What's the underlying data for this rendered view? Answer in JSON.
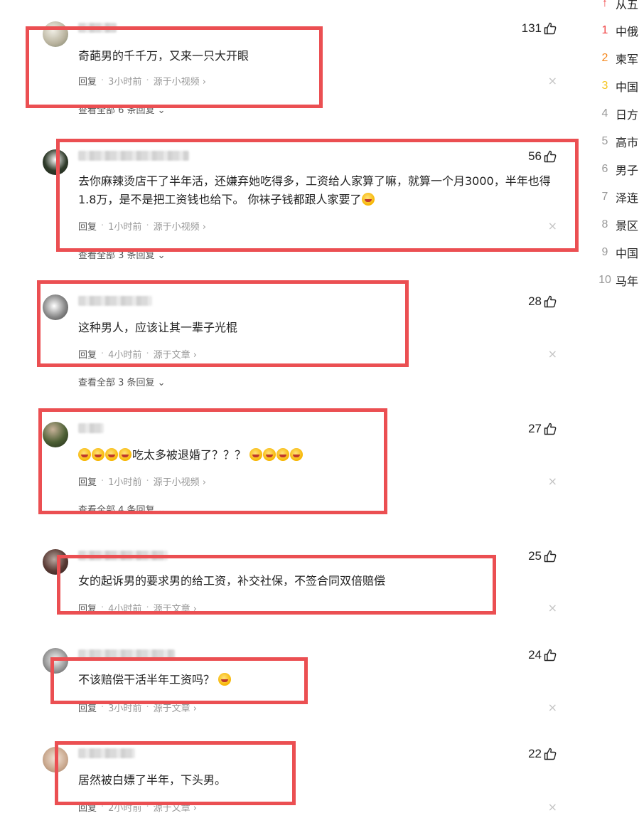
{
  "comments": [
    {
      "likes": "131",
      "text": "奇葩男的千千万，又来一只大开眼",
      "reply": "回复",
      "time": "3小时前",
      "source": "源于小视频 ›",
      "view_all": "查看全部 6 条回复 ⌄"
    },
    {
      "likes": "56",
      "text": "去你麻辣烫店干了半年活，还嫌弃她吃得多，工资给人家算了嘛，就算一个月3000，半年也得1.8万，是不是把工资钱也给下。 你袜子钱都跟人家要了",
      "reply": "回复",
      "time": "1小时前",
      "source": "源于小视频 ›",
      "view_all": "查看全部 3 条回复 ⌄"
    },
    {
      "likes": "28",
      "text": "这种男人，应该让其一辈子光棍",
      "reply": "回复",
      "time": "4小时前",
      "source": "源于文章 ›",
      "view_all": "查看全部 3 条回复 ⌄"
    },
    {
      "likes": "27",
      "text": "吃太多被退婚了？？？",
      "reply": "回复",
      "time": "1小时前",
      "source": "源于小视频 ›",
      "view_all": "查看全部 4 条回复 ⌄"
    },
    {
      "likes": "25",
      "text": "女的起诉男的要求男的给工资，补交社保，不签合同双倍赔偿",
      "reply": "回复",
      "time": "4小时前",
      "source": "源于文章 ›"
    },
    {
      "likes": "24",
      "text": "不该赔偿干活半年工资吗？",
      "reply": "回复",
      "time": "3小时前",
      "source": "源于文章 ›"
    },
    {
      "likes": "22",
      "text": "居然被白嫖了半年，下头男。",
      "reply": "回复",
      "time": "2小时前",
      "source": "源于文章 ›"
    }
  ],
  "hot_list": [
    {
      "rank": "↑",
      "title": "从五",
      "color": "#f04142"
    },
    {
      "rank": "1",
      "title": "中俄",
      "color": "#f04142"
    },
    {
      "rank": "2",
      "title": "柬军",
      "color": "#f5891f"
    },
    {
      "rank": "3",
      "title": "中国",
      "color": "#f5c51f"
    },
    {
      "rank": "4",
      "title": "日方",
      "color": "#999999"
    },
    {
      "rank": "5",
      "title": "高市",
      "color": "#999999"
    },
    {
      "rank": "6",
      "title": "男子",
      "color": "#999999"
    },
    {
      "rank": "7",
      "title": "泽连",
      "color": "#999999"
    },
    {
      "rank": "8",
      "title": "景区",
      "color": "#999999"
    },
    {
      "rank": "9",
      "title": "中国",
      "color": "#999999"
    },
    {
      "rank": "10",
      "title": "马年",
      "color": "#999999"
    }
  ],
  "dot": "·",
  "close": "×"
}
